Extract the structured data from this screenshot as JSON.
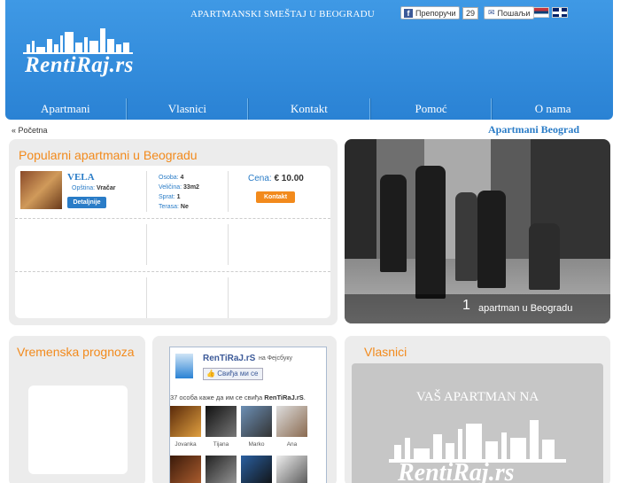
{
  "header": {
    "tagline": "APARTMANSKI SMEŠTAJ U BEOGRADU",
    "recommend_label": "Препоручи",
    "recommend_count": "29",
    "send_label": "Пошаљи",
    "logo_text": "RentiRaj.rs",
    "flags": [
      "serbian-flag-icon",
      "english-flag-icon"
    ]
  },
  "nav": {
    "items": [
      "Apartmani",
      "Vlasnici",
      "Kontakt",
      "Pomoć",
      "O nama"
    ]
  },
  "breadcrumb": "« Početna",
  "right_title": "Apartmani Beograd",
  "popular": {
    "title": "Popularni apartmani u Beogradu",
    "apartment": {
      "name": "VELA",
      "area_label": "Opština:",
      "area_value": "Vračar",
      "details_label": "Detaljnije",
      "persons_label": "Osoba:",
      "persons_value": "4",
      "size_label": "Veličina:",
      "size_value": "33m2",
      "floor_label": "Sprat:",
      "floor_value": "1",
      "terrace_label": "Terasa:",
      "terrace_value": "Ne",
      "price_label": "Cena:",
      "price_value": "€ 10.00",
      "contact_label": "Kontakt"
    }
  },
  "photo": {
    "number": "1",
    "caption": "apartman u Beogradu"
  },
  "weather": {
    "title": "Vremenska prognoza"
  },
  "facebook": {
    "page_name": "RenTiRaJ.rS",
    "on_label": "на Фејсбуку",
    "like_label": "Свиђа ми се",
    "count_pre": "37 особа каже да им се свиђа ",
    "count_name": "RenTiRaJ.rS",
    "count_post": ".",
    "fans": [
      "Jovanka",
      "Tijana",
      "Marko",
      "Ana"
    ]
  },
  "owners": {
    "title": "Vlasnici",
    "banner_text": "VAŠ APARTMAN NA",
    "banner_logo": "RentiRaj.rs"
  },
  "colors": {
    "header_blue": "#2a82d4",
    "accent_orange": "#f28a1c",
    "link_blue": "#2a7cc7"
  }
}
